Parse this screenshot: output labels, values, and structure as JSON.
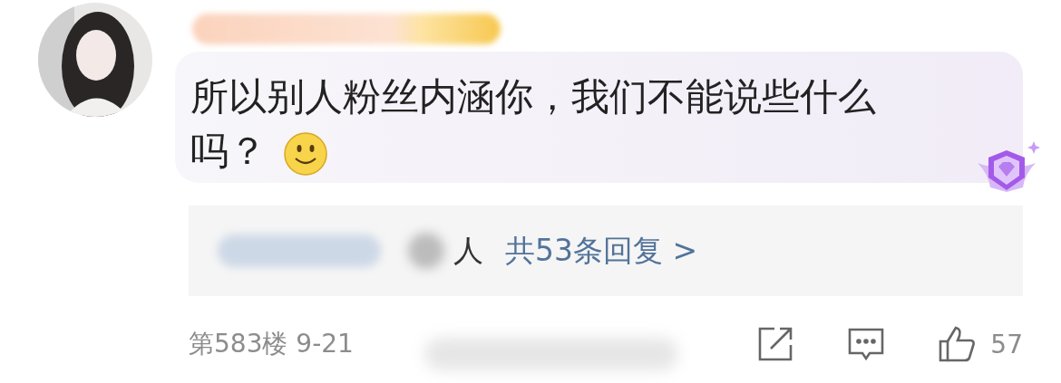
{
  "comment": {
    "text": "所以别人粉丝内涵你，我们不能说些什么吗？"
  },
  "replies": {
    "suffix": "人",
    "link": "共53条回复 >"
  },
  "footer": {
    "meta": "第583楼 9-21",
    "likes": "57"
  }
}
